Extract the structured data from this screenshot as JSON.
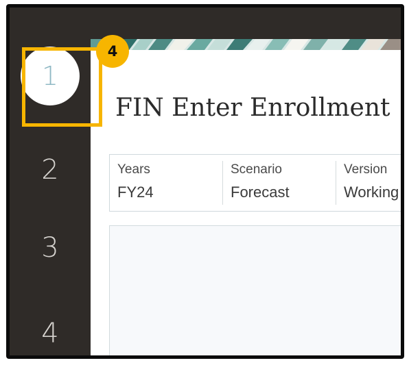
{
  "callout": {
    "label": "4"
  },
  "rail": {
    "items": [
      {
        "label": "1",
        "active": true
      },
      {
        "label": "2",
        "active": false
      },
      {
        "label": "3",
        "active": false
      },
      {
        "label": "4",
        "active": false
      }
    ]
  },
  "page": {
    "title": "FIN Enter Enrollment"
  },
  "pov": [
    {
      "label": "Years",
      "value": "FY24"
    },
    {
      "label": "Scenario",
      "value": "Forecast"
    },
    {
      "label": "Version",
      "value": "Working"
    }
  ],
  "colors": {
    "rail_bg": "#2f2b28",
    "highlight": "#f7b500",
    "active_number": "#8fb8c4"
  }
}
